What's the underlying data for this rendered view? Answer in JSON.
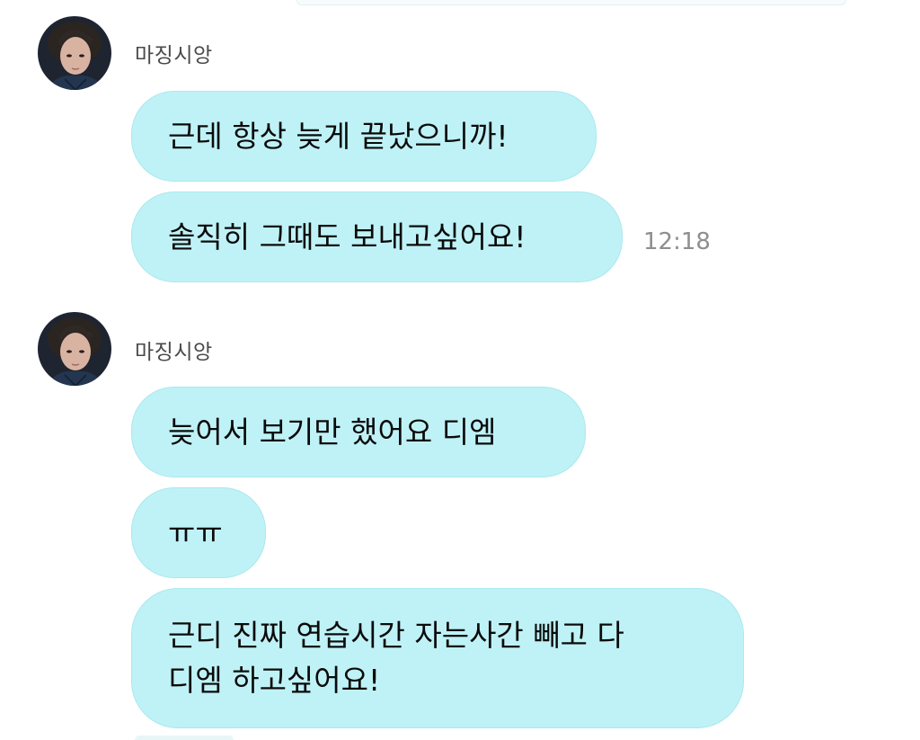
{
  "chat": {
    "groups": [
      {
        "sender": "마징시앙",
        "messages": [
          {
            "text": "근데 항상 늦게 끝났으니까!"
          },
          {
            "text": "솔직히 그때도 보내고싶어요!",
            "time": "12:18"
          }
        ]
      },
      {
        "sender": "마징시앙",
        "messages": [
          {
            "text": "늦어서 보기만 했어요 디엠"
          },
          {
            "text": "ㅠㅠ"
          },
          {
            "lines": [
              "근디 진짜 연습시간 자는사간 빼고 다",
              "디엠 하고싶어요!"
            ]
          }
        ]
      }
    ]
  },
  "colors": {
    "bubble": "#bff2f6",
    "bubble_border": "#a9e8ee",
    "sender_name": "#4a4a4a",
    "timestamp": "#8e8e8e"
  },
  "icons": {
    "avatar": "profile-photo"
  }
}
